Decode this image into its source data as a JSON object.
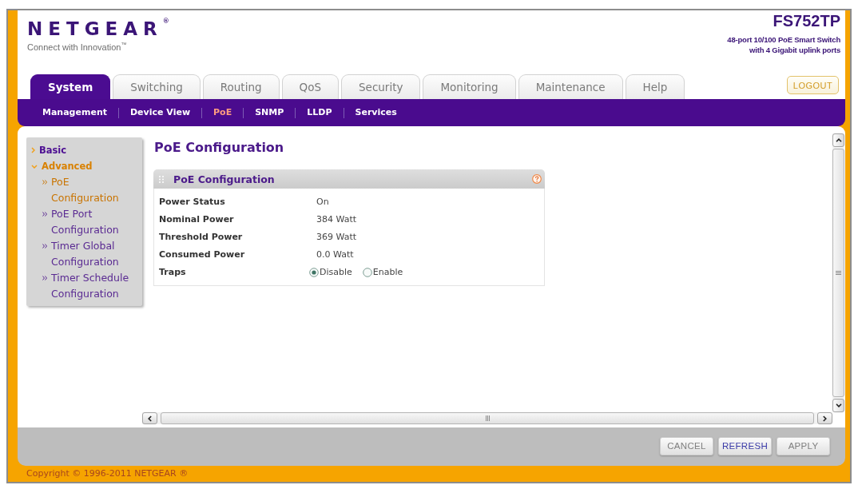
{
  "header": {
    "logo": "NETGEAR$^{®}$",
    "tagline": "Connect with Innovation$^{™}$",
    "model": "FS752TP",
    "description": [
      "48-port 10/100 PoE Smart Switch",
      "with 4 Gigabit uplink ports"
    ]
  },
  "tabs": [
    {
      "label": "System",
      "selected": true
    },
    {
      "label": "Switching",
      "selected": false
    },
    {
      "label": "Routing",
      "selected": false
    },
    {
      "label": "QoS",
      "selected": false
    },
    {
      "label": "Security",
      "selected": false
    },
    {
      "label": "Monitoring",
      "selected": false
    },
    {
      "label": "Maintenance",
      "selected": false
    },
    {
      "label": "Help",
      "selected": false
    }
  ],
  "logout_button": "LOGOUT",
  "subnav": [
    {
      "label": "Management",
      "selected": false
    },
    {
      "label": "Device View",
      "selected": false
    },
    {
      "label": "PoE",
      "selected": true
    },
    {
      "label": "SNMP",
      "selected": false
    },
    {
      "label": "LLDP",
      "selected": false
    },
    {
      "label": "Services",
      "selected": false
    }
  ],
  "sidebar": {
    "items": [
      {
        "label": "Basic",
        "expanded": false
      },
      {
        "label": "Advanced",
        "expanded": true,
        "children": [
          {
            "label": "PoE Configuration",
            "selected": true
          },
          {
            "label": "PoE Port Configuration",
            "selected": false
          },
          {
            "label": "Timer Global Configuration",
            "selected": false
          },
          {
            "label": "Timer Schedule Configuration",
            "selected": false
          }
        ]
      }
    ]
  },
  "page_title": "PoE Configuration",
  "panel": {
    "title": "PoE Configuration",
    "rows": [
      {
        "kind": "text",
        "label": "Power Status",
        "value": "On"
      },
      {
        "kind": "text",
        "label": "Nominal Power",
        "value": "384 Watt"
      },
      {
        "kind": "text",
        "label": "Threshold Power",
        "value": "369 Watt"
      },
      {
        "kind": "text",
        "label": "Consumed Power",
        "value": "0.0 Watt"
      },
      {
        "kind": "radio",
        "label": "Traps",
        "options": [
          {
            "label": "Disable",
            "selected": true
          },
          {
            "label": "Enable",
            "selected": false
          }
        ]
      }
    ]
  },
  "buttons": [
    {
      "label": "CANCEL",
      "disabled": true
    },
    {
      "label": "REFRESH",
      "disabled": false
    },
    {
      "label": "APPLY",
      "disabled": true
    }
  ],
  "footer": {
    "copyright": "Copyright © 1996-2011 NETGEAR ®"
  }
}
